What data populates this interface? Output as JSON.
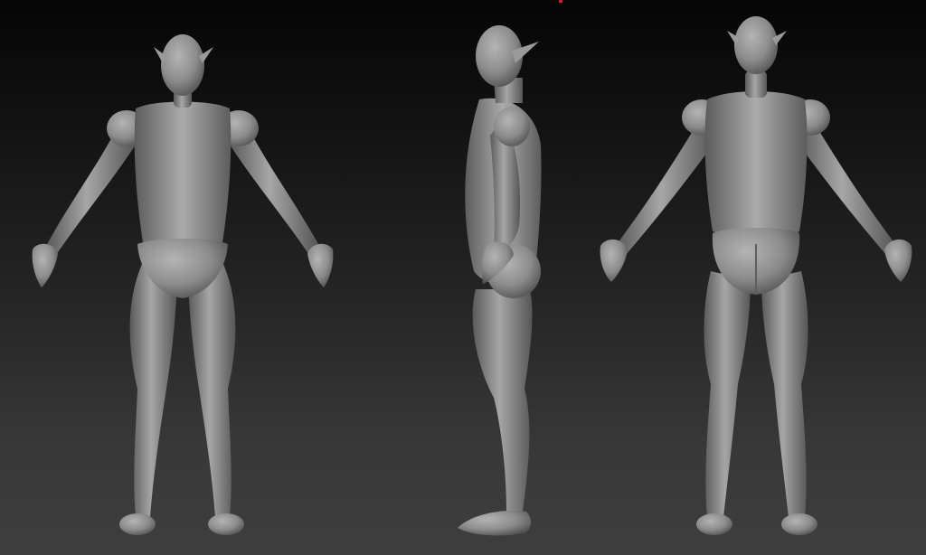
{
  "scene": {
    "background_top": "#050505",
    "background_bottom": "#3e3e3e",
    "model_color": "#8c8c8c",
    "model_highlight": "#b4b4b4",
    "model_shadow": "#4a4a4a",
    "accent_mark_color": "#cc2020",
    "views": [
      "front",
      "side",
      "back"
    ]
  }
}
